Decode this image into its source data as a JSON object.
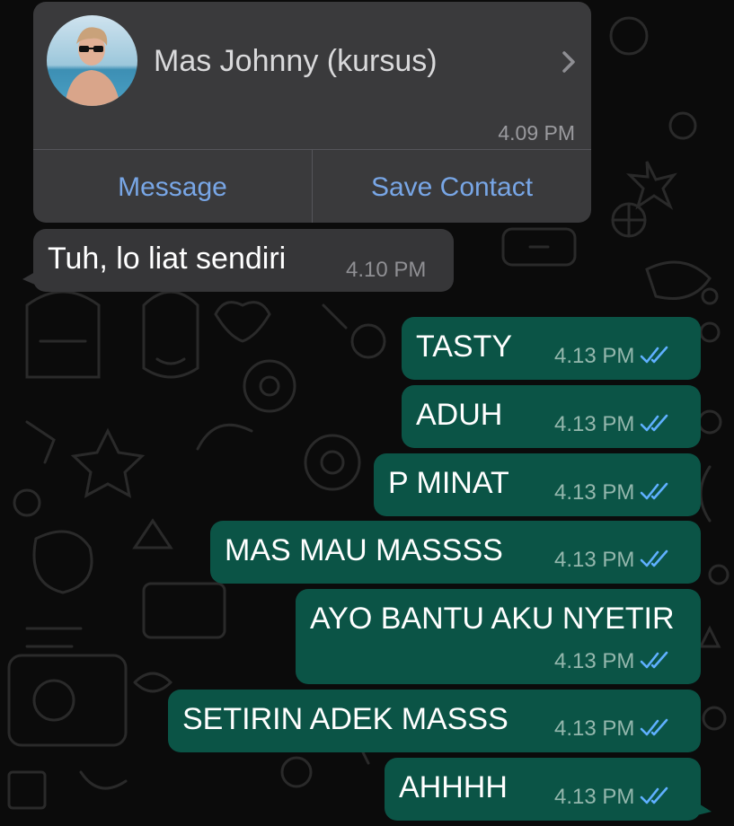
{
  "contact_card": {
    "name": "Mas Johnny (kursus)",
    "time": "4.09 PM",
    "message_button": "Message",
    "save_contact_button": "Save Contact"
  },
  "incoming": [
    {
      "text": "Tuh, lo liat sendiri",
      "time": "4.10 PM"
    }
  ],
  "outgoing": [
    {
      "text": "TASTY",
      "time": "4.13 PM"
    },
    {
      "text": "ADUH",
      "time": "4.13 PM"
    },
    {
      "text": "P MINAT",
      "time": "4.13 PM"
    },
    {
      "text": "MAS MAU MASSSS",
      "time": "4.13 PM"
    },
    {
      "text": "AYO BANTU AKU NYETIR",
      "time": "4.13 PM"
    },
    {
      "text": "SETIRIN ADEK MASSS",
      "time": "4.13 PM"
    },
    {
      "text": "AHHHH",
      "time": "4.13 PM"
    }
  ],
  "colors": {
    "outgoing_bubble": "#0b5446",
    "incoming_bubble": "#363638",
    "card": "#3a3a3c",
    "link": "#78a6e6",
    "read_ticks": "#5fb0ff"
  }
}
